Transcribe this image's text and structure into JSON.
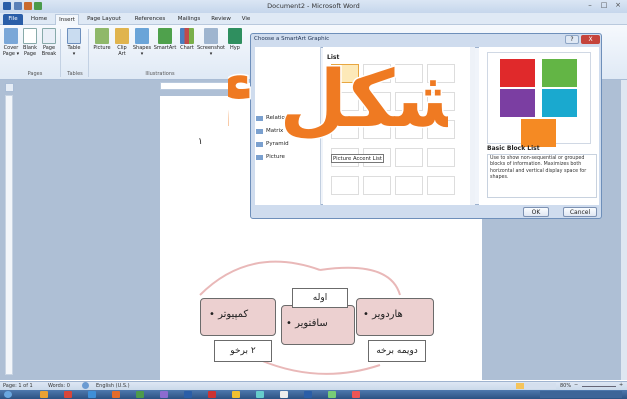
{
  "window": {
    "title": "Document2 - Microsoft Word"
  },
  "tabs": [
    "File",
    "Home",
    "Insert",
    "Page Layout",
    "References",
    "Mailings",
    "Review"
  ],
  "tab_cut": "Vie",
  "ribbon": {
    "buttons": [
      {
        "label": "Cover\nPage ▾",
        "icon": "cover-page-icon"
      },
      {
        "label": "Blank\nPage",
        "icon": "blank-page-icon"
      },
      {
        "label": "Page\nBreak",
        "icon": "page-break-icon"
      },
      {
        "label": "Table\n▾",
        "icon": "table-icon"
      },
      {
        "label": "Picture",
        "icon": "picture-icon"
      },
      {
        "label": "Clip\nArt",
        "icon": "clip-art-icon"
      },
      {
        "label": "Shapes\n▾",
        "icon": "shapes-icon"
      },
      {
        "label": "SmartArt",
        "icon": "smartart-icon"
      },
      {
        "label": "Chart",
        "icon": "chart-icon"
      },
      {
        "label": "Screenshot\n▾",
        "icon": "screenshot-icon"
      },
      {
        "label": "Hyp",
        "icon": "hyperlink-icon"
      }
    ],
    "groups": [
      "Pages",
      "Tables",
      "Illustrations"
    ]
  },
  "dialog": {
    "title": "Choose a SmartArt Graphic",
    "categories": [
      "Relationship",
      "Matrix",
      "Pyramid",
      "Picture"
    ],
    "gallery_title": "List",
    "tooltip": "Picture Accent List",
    "preview_name": "Basic Block List",
    "preview_desc": "Use to show non-sequential or grouped blocks of information. Maximizes both horizontal and vertical display space for shapes.",
    "ok": "OK",
    "cancel": "Cancel",
    "help": "?",
    "close": "X"
  },
  "overlay_text": "۴ شکل",
  "document": {
    "page_number": "۱",
    "smartart": {
      "item1": "کمپیوتر",
      "item2": "سافتویر",
      "item3": "هاردویر",
      "label1": "اوله",
      "label2": "۲ برخو",
      "label3": "دویمه برخه",
      "bullet": "•"
    }
  },
  "status": {
    "page": "Page: 1 of 1",
    "words": "Words: 0",
    "lang": "English (U.S.)",
    "zoom": "80%",
    "minus": "−",
    "plus": "+"
  },
  "colors": {
    "overlay": "#ef7a22",
    "preview_red": "#e0292b",
    "preview_green": "#63b545",
    "preview_purple": "#7b3ea2",
    "preview_teal": "#1aa9cf",
    "preview_orange": "#f58a23",
    "smartart_fill": "#ecd0d0"
  }
}
